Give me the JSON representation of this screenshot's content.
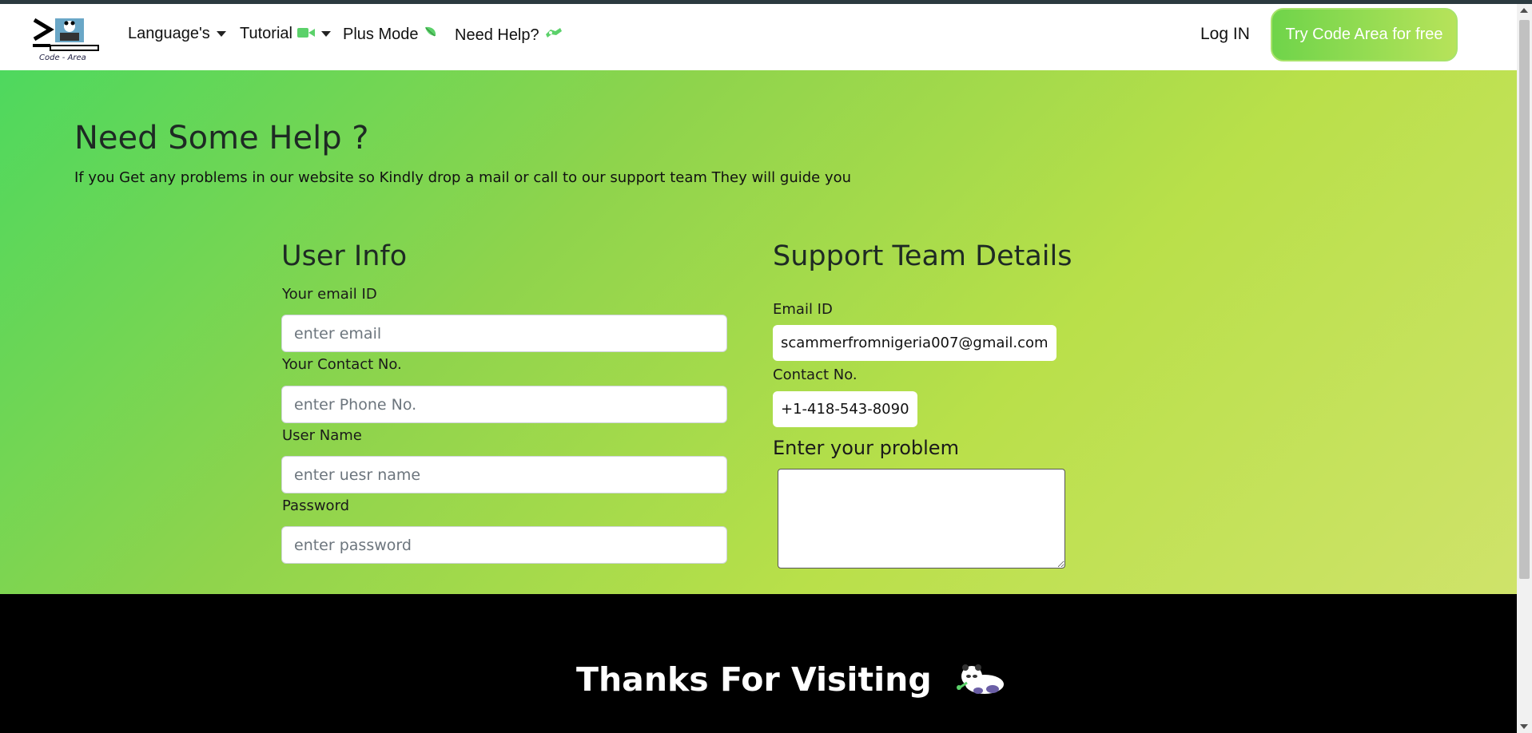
{
  "navbar": {
    "logo_text": "Code - Area",
    "items": [
      {
        "label": "Language's",
        "icon": "caret-down-icon"
      },
      {
        "label": "Tutorial",
        "icon": "video-camera-icon"
      },
      {
        "label": "Plus Mode",
        "icon": "leaf-icon"
      },
      {
        "label": "Need Help?",
        "icon": "support-icon"
      }
    ],
    "login_label": "Log IN",
    "try_label": "Try Code Area for free"
  },
  "hero": {
    "title": "Need Some Help ?",
    "subtitle": "If you Get any problems in our website so Kindly drop a mail or call to our support team They will guide you"
  },
  "user_info": {
    "title": "User Info",
    "email_label": "Your email ID",
    "email_placeholder": "enter email",
    "contact_label": "Your Contact No.",
    "contact_placeholder": "enter Phone No.",
    "username_label": "User Name",
    "username_placeholder": "enter uesr name",
    "password_label": "Password",
    "password_placeholder": "enter password"
  },
  "support": {
    "title": "Support Team Details",
    "email_label": "Email ID",
    "email_value": "scammerfromnigeria007@gmail.com",
    "contact_label": "Contact No.",
    "contact_value": "+1-418-543-8090",
    "problem_label": "Enter your problem"
  },
  "footer": {
    "thanks": "Thanks For Visiting"
  },
  "colors": {
    "accent_green": "#4ed85e",
    "accent_lime": "#cfe36a",
    "footer_bg": "#000000"
  }
}
